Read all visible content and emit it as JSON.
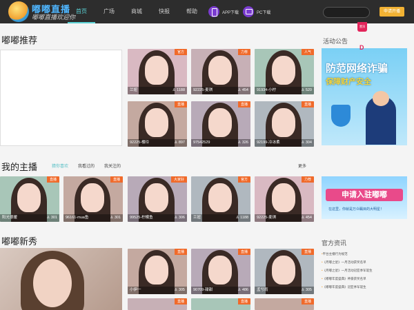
{
  "header": {
    "logo_text": "嘟嘟直播",
    "slogan": "嘟嘟直播欢迎你",
    "nav": [
      "首页",
      "广场",
      "商城",
      "快报",
      "帮助"
    ],
    "app_download": "APP下载",
    "pc_download": "PC下载",
    "apply_button": "申请开播"
  },
  "sections": {
    "recommend": "嘟嘟推荐",
    "my_anchor": "我的主播",
    "new_show": "嘟嘟新秀"
  },
  "my_anchor_tabs": [
    "猜你喜欢",
    "我看过的",
    "我关注的"
  ],
  "more_label": "更多",
  "side": {
    "notice_title": "活动公告",
    "pin_label": "置顶",
    "pin_letter": "D",
    "ad1_line1": "防范网络诈骗",
    "ad1_line2": "保障财产安全",
    "ad2_line1": "申请入驻嘟嘟",
    "ad2_line2": "在这里，你就是万众瞩目的大明星！",
    "news_title": "官方资讯",
    "news": [
      "平台主播行为规范",
      "《月嘟之星》一月活动获奖名单",
      "《月嘟之星》一月活动冠亚季军诞生",
      "《嘟嘟年度盛典》神豪获奖名单",
      "《嘟嘟年度盛典》冠亚季军诞生"
    ]
  },
  "recommend_cards": [
    {
      "badge": "官方",
      "name": "兰妞",
      "count": "1188"
    },
    {
      "badge": "力荐",
      "name": "92225-麦琪",
      "count": "454"
    },
    {
      "badge": "人气",
      "name": "91934-小柠",
      "count": "520"
    },
    {
      "badge": "直播",
      "name": "92225-楼玲",
      "count": "897"
    },
    {
      "badge": "直播",
      "name": "97542529",
      "count": "326"
    },
    {
      "badge": "直播",
      "name": "92199-冷冰柔",
      "count": "304"
    }
  ],
  "anchor_cards": [
    {
      "badge": "直播",
      "name": "阳光很暖",
      "count": "301"
    },
    {
      "badge": "直播",
      "name": "96161-mua鱼",
      "count": "301"
    },
    {
      "badge": "大家好",
      "name": "99525-柠檬鱼",
      "count": "306"
    },
    {
      "badge": "官方",
      "name": "兰妞",
      "count": "1188"
    },
    {
      "badge": "力荐",
      "name": "92225-麦琪",
      "count": "454"
    }
  ],
  "new_cards": [
    {
      "badge": "直播",
      "name": "小伊一",
      "count": "305"
    },
    {
      "badge": "直播",
      "name": "90709-甜甜",
      "count": "486"
    },
    {
      "badge": "直播",
      "name": "孟兮雨",
      "count": "305"
    }
  ],
  "new_cards_bottom": [
    "直播",
    "直播",
    "直播"
  ],
  "colors": {
    "accent": "#5bd2d6",
    "badge": "#f06a2a",
    "apply": "#f2b233"
  }
}
